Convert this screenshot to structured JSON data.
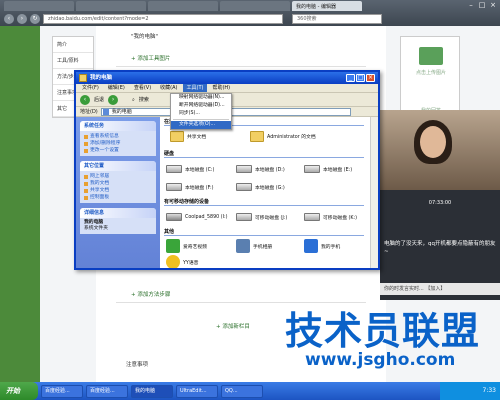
{
  "browser": {
    "tabs": [
      "",
      "",
      "",
      "",
      "",
      "我的电脑 - 编辑器"
    ],
    "address": "zhidao.baidu.com/edit/content?mode=2",
    "search_placeholder": "360搜索"
  },
  "page": {
    "side_menu": [
      "简介",
      "工具/原料",
      "方法/步骤",
      "注意事项",
      "其它"
    ],
    "link_my_computer": "\"我的电脑\"",
    "add_toolbox_image": "+ 添加工具图片",
    "add_method_step": "+ 添加方法步骤",
    "add_column": "+ 添加新栏目",
    "notes_title": "注意事项",
    "right_panel_label": "点击上传图片",
    "right_panel_label2": "我的回答"
  },
  "explorer": {
    "title": "我的电脑",
    "menu": [
      "文件(F)",
      "编辑(E)",
      "查看(V)",
      "收藏(A)",
      "工具(T)",
      "帮助(H)"
    ],
    "toolbar_back": "后退",
    "toolbar_search": "搜索",
    "address_label": "地址(D)",
    "address_value": "我的电脑",
    "tools_menu": [
      "映射网络驱动器(N)...",
      "断开网络驱动器(D)...",
      "同步(S)...",
      "文件夹选项(O)..."
    ],
    "taskpane": {
      "system_tasks_title": "系统任务",
      "system_tasks": [
        "查看系统信息",
        "添加/删除程序",
        "更改一个设置"
      ],
      "other_places_title": "其它位置",
      "other_places": [
        "网上邻居",
        "我的文档",
        "共享文档",
        "控制面板"
      ],
      "details_title": "详细信息",
      "details_name": "我的电脑",
      "details_desc": "系统文件夹"
    },
    "groups": {
      "files_title": "在这台计算机上存储的文件",
      "shared_docs": "共享文档",
      "admin_docs": "Administrator 的文档",
      "disks_title": "硬盘",
      "drive_c": "本地磁盘 (C:)",
      "drive_d": "本地磁盘 (D:)",
      "drive_e": "本地磁盘 (E:)",
      "drive_f": "本地磁盘 (F:)",
      "drive_g": "本地磁盘 (G:)",
      "removable_title": "有可移动存储的设备",
      "coolpad": "Coolpad_5890 (I:)",
      "removable_j": "可移动磁盘 (J:)",
      "removable_k": "可移动磁盘 (K:)",
      "other_title": "其他",
      "iqiyi": "爱奇艺视频",
      "phone_mgr": "手机相册",
      "my_phone": "我的手机",
      "yy": "YY语音"
    }
  },
  "video": {
    "time": "07:33:00",
    "chat": "电脑的了没天来，qq开机都要点隐蔽有的朋友~",
    "input": "你的时发言实时... 【加入】"
  },
  "watermark": {
    "main": "技术员联盟",
    "sub": "www.jsgho.com"
  },
  "taskbar": {
    "start": "开始",
    "buttons": [
      "百度经验...",
      "百度经验...",
      "我的电脑",
      "UltraEdit...",
      "QQ..."
    ],
    "clock": "7:33"
  },
  "colors": {
    "xp_blue": "#0a3ec2",
    "accent_green": "#4c8a3a",
    "watermark_blue": "#0a62c8"
  }
}
